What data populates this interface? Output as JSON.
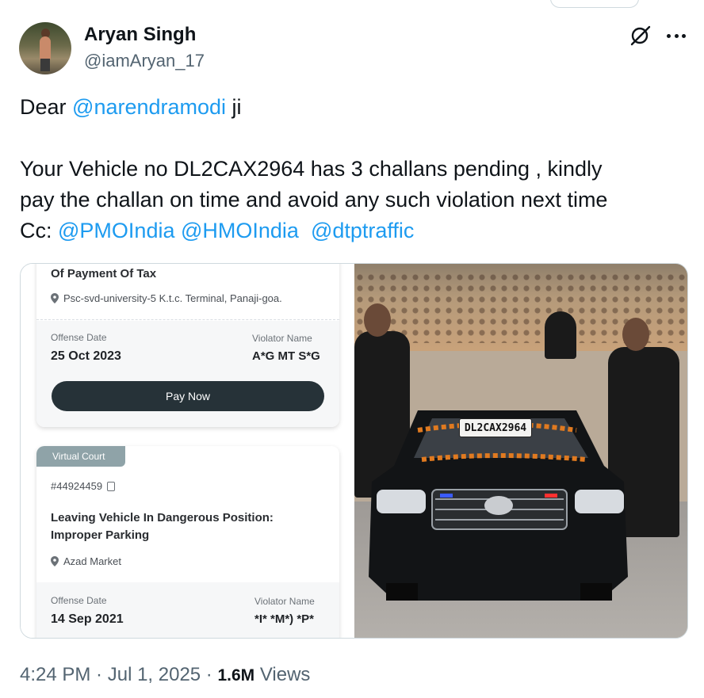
{
  "author": {
    "name": "Aryan Singh",
    "handle": "@iamAryan_17"
  },
  "tweet": {
    "greeting_prefix": "Dear ",
    "greeting_mention": "@narendramodi",
    "greeting_suffix": " ji",
    "body_line1": "Your Vehicle no DL2CAX2964 has 3 challans pending , kindly",
    "body_line2": "pay the challan on time and avoid any such violation next time",
    "cc_label": "Cc: ",
    "cc_mentions": [
      "@PMOIndia",
      "@HMOIndia",
      "@dtptraffic"
    ]
  },
  "challan_screenshot": {
    "card1": {
      "title": "Of Payment Of Tax",
      "location": "Psc-svd-university-5 K.t.c. Terminal, Panaji-goa.",
      "offense_date_label": "Offense Date",
      "offense_date": "25 Oct 2023",
      "violator_label": "Violator Name",
      "violator_name": "A*G MT S*G",
      "pay_button": "Pay Now"
    },
    "card2": {
      "badge": "Virtual Court",
      "challan_id": "#44924459",
      "title_line1": "Leaving Vehicle In Dangerous Position:",
      "title_line2": "Improper Parking",
      "location": "Azad Market",
      "offense_date_label": "Offense Date",
      "offense_date": "14 Sep 2021",
      "violator_label": "Violator Name",
      "violator_name": "*I* *M*) *P*"
    }
  },
  "photo": {
    "plate_text": "DL2CAX2964"
  },
  "meta": {
    "time": "4:24 PM",
    "separator": " · ",
    "date": "Jul 1, 2025",
    "views_count": "1.6M",
    "views_label": " Views"
  },
  "colors": {
    "mention": "#1d9bf0",
    "secondary_text": "#536471",
    "primary_text": "#0f1419",
    "pay_button": "#263238"
  }
}
